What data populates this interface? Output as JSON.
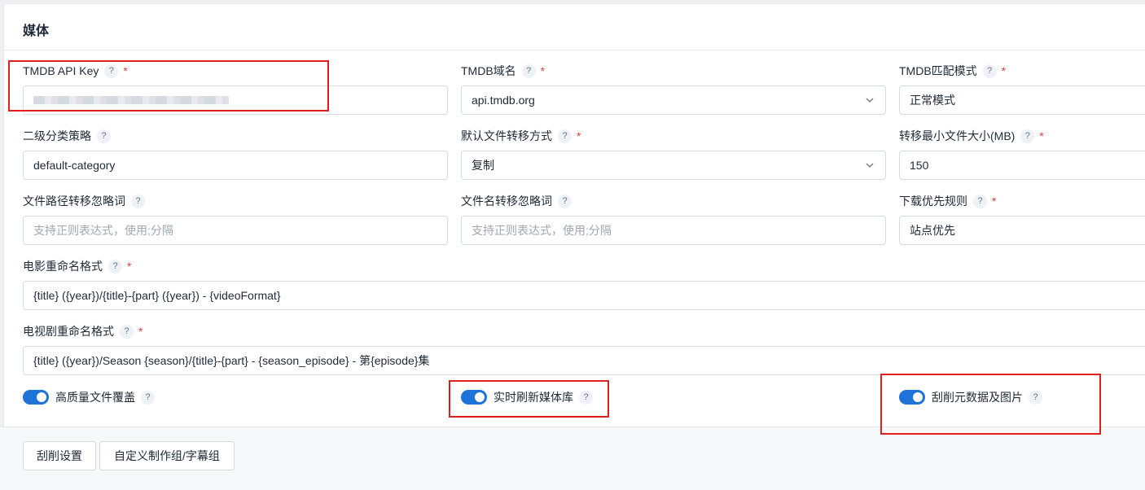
{
  "section": {
    "title": "媒体"
  },
  "fields": {
    "tmdb_api_key": {
      "label": "TMDB API Key"
    },
    "tmdb_domain": {
      "label": "TMDB域名",
      "value": "api.tmdb.org"
    },
    "tmdb_match_mode": {
      "label": "TMDB匹配模式",
      "value": "正常模式"
    },
    "secondary_category": {
      "label": "二级分类策略",
      "value": "default-category"
    },
    "default_transfer": {
      "label": "默认文件转移方式",
      "value": "复制"
    },
    "min_file_size": {
      "label": "转移最小文件大小(MB)",
      "value": "150"
    },
    "path_ignore": {
      "label": "文件路径转移忽略词",
      "placeholder": "支持正则表达式，使用;分隔"
    },
    "name_ignore": {
      "label": "文件名转移忽略词",
      "placeholder": "支持正则表达式，使用;分隔"
    },
    "download_priority": {
      "label": "下载优先规则",
      "value": "站点优先"
    },
    "movie_rename": {
      "label": "电影重命名格式",
      "value": "{title} ({year})/{title}-{part} ({year}) - {videoFormat}"
    },
    "tv_rename": {
      "label": "电视剧重命名格式",
      "value": "{title} ({year})/Season {season}/{title}-{part} - {season_episode} - 第{episode}集"
    }
  },
  "switches": {
    "hq_overwrite": {
      "label": "高质量文件覆盖",
      "on": true
    },
    "refresh_library": {
      "label": "实时刷新媒体库",
      "on": true
    },
    "scrape_metadata": {
      "label": "刮削元数据及图片",
      "on": true
    }
  },
  "help_mark": "?",
  "required_mark": "*",
  "buttons": {
    "scrape_settings": "刮削设置",
    "custom_groups": "自定义制作组/字幕组"
  },
  "colors": {
    "accent": "#1e73d8",
    "required": "#e53e3e",
    "annotation": "#e02020"
  }
}
